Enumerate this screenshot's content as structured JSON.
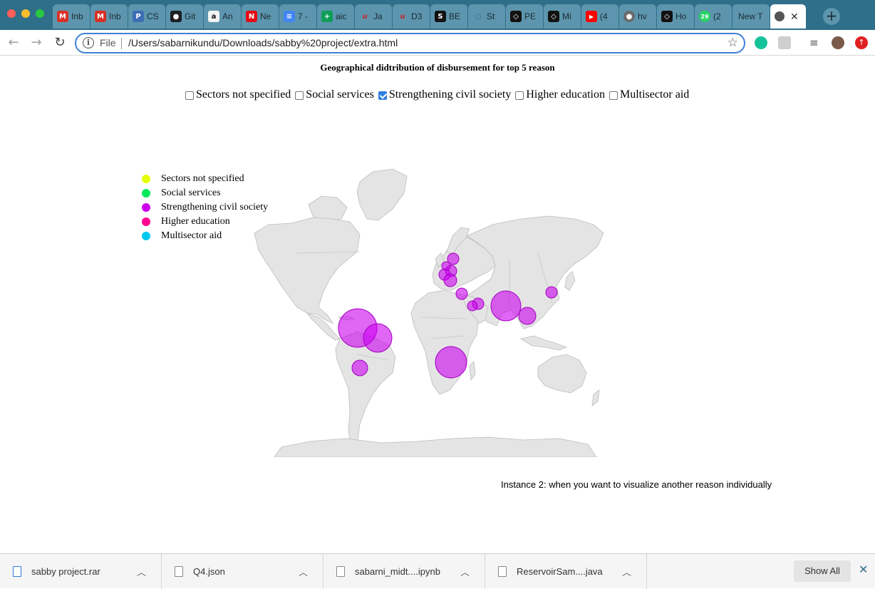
{
  "browser": {
    "tabs": [
      {
        "label": "Inb",
        "icon": "gmail-icon",
        "color": "#d93025",
        "glyph": "M"
      },
      {
        "label": "Inb",
        "icon": "gmail-icon",
        "color": "#d93025",
        "glyph": "M"
      },
      {
        "label": "CS",
        "icon": "p-icon",
        "color": "#3b6db5",
        "glyph": "P"
      },
      {
        "label": "Git",
        "icon": "github-icon",
        "color": "#1b1f23",
        "glyph": "●"
      },
      {
        "label": "An",
        "icon": "amazon-icon",
        "color": "#f3f3f3",
        "glyph": "a"
      },
      {
        "label": "Ne",
        "icon": "netflix-icon",
        "color": "#e50914",
        "glyph": "N"
      },
      {
        "label": "7 -",
        "icon": "docs-icon",
        "color": "#4285f4",
        "glyph": "≡"
      },
      {
        "label": "aic",
        "icon": "sheets-icon",
        "color": "#0f9d58",
        "glyph": "+"
      },
      {
        "label": "Ja",
        "icon": "u-icon",
        "color": "#5c95ad",
        "glyph": "u"
      },
      {
        "label": "D3",
        "icon": "u-icon",
        "color": "#5c95ad",
        "glyph": "u"
      },
      {
        "label": "BE",
        "icon": "s-icon",
        "color": "#111111",
        "glyph": "S"
      },
      {
        "label": "St",
        "icon": "circle-icon",
        "color": "#5c95ad",
        "glyph": "○"
      },
      {
        "label": "PE",
        "icon": "codepen-icon",
        "color": "#111111",
        "glyph": "◇"
      },
      {
        "label": "Mi",
        "icon": "codepen-icon",
        "color": "#111111",
        "glyph": "◇"
      },
      {
        "label": "(4",
        "icon": "youtube-icon",
        "color": "#ff0000",
        "glyph": "▶"
      },
      {
        "label": "hv",
        "icon": "globe-icon",
        "color": "#6b6b6b",
        "glyph": "●"
      },
      {
        "label": "Ho",
        "icon": "codepen-icon",
        "color": "#111111",
        "glyph": "◇"
      },
      {
        "label": "(2",
        "icon": "whatsapp-icon",
        "color": "#25d366",
        "glyph": "29"
      },
      {
        "label": "New T",
        "icon": "",
        "color": "",
        "glyph": ""
      }
    ],
    "active_tab_icon": "globe-icon",
    "url_scheme": "File",
    "url": "/Users/sabarnikundu/Downloads/sabby%20project/extra.html"
  },
  "page": {
    "title": "Geographical didtribution of disbursement for top 5 reason",
    "filters": [
      {
        "label": "Sectors not specified",
        "checked": false
      },
      {
        "label": "Social services",
        "checked": false
      },
      {
        "label": "Strengthening civil society",
        "checked": true
      },
      {
        "label": "Higher education",
        "checked": false
      },
      {
        "label": "Multisector aid",
        "checked": false
      }
    ],
    "legend": [
      {
        "label": "Sectors not specified",
        "color": "#e5ff00"
      },
      {
        "label": "Social services",
        "color": "#00e85a"
      },
      {
        "label": "Strengthening civil society",
        "color": "#cc00ee"
      },
      {
        "label": "Higher education",
        "color": "#ff0090"
      },
      {
        "label": "Multisector aid",
        "color": "#00c8f0"
      }
    ],
    "bubble_color": "#cc00ee",
    "caption": "Instance 2: when you want to visualize another reason individually"
  },
  "downloads": {
    "items": [
      {
        "name": "sabby project.rar"
      },
      {
        "name": "Q4.json"
      },
      {
        "name": "sabarni_midt....ipynb"
      },
      {
        "name": "ReservoirSam....java"
      }
    ],
    "show_all": "Show All"
  }
}
